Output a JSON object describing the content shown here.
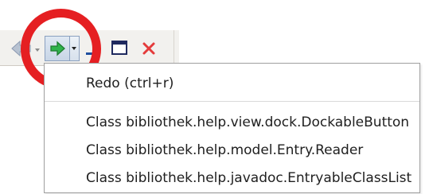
{
  "toolbar": {
    "buttons": [
      {
        "name": "back-button",
        "icon": "back-arrow-icon",
        "state": "disabled",
        "color": "#9aa7bb"
      },
      {
        "name": "back-dropdown-button",
        "icon": "chevron-down-icon",
        "state": "disabled",
        "color": "#8b8b8b"
      },
      {
        "name": "forward-button",
        "icon": "forward-arrow-icon",
        "state": "enabled",
        "color": "#2ea44f"
      },
      {
        "name": "forward-dropdown-button",
        "icon": "chevron-down-icon",
        "state": "enabled",
        "color": "#333333"
      },
      {
        "name": "minimize-button",
        "icon": "minimize-icon",
        "state": "enabled",
        "color": "#1c4f9c"
      },
      {
        "name": "maximize-button",
        "icon": "maximize-icon",
        "state": "enabled",
        "color": "#1d2a5c"
      },
      {
        "name": "close-button",
        "icon": "close-icon",
        "state": "enabled",
        "color": "#e43b3b"
      }
    ]
  },
  "menu": {
    "items": [
      {
        "label": "Redo (ctrl+r)"
      },
      {
        "label": "Class bibliothek.help.view.dock.DockableButton"
      },
      {
        "label": "Class bibliothek.help.model.Entry.Reader"
      },
      {
        "label": "Class bibliothek.help.javadoc.EntryableClassList"
      }
    ]
  },
  "highlight": {
    "color": "#e51f22"
  }
}
